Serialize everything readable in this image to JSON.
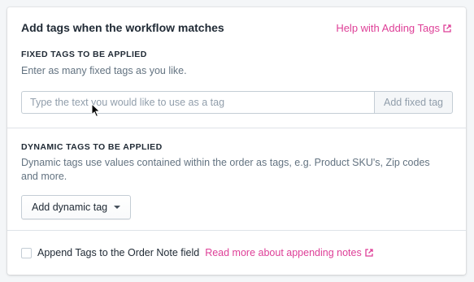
{
  "card": {
    "title": "Add tags when the workflow matches",
    "help_link": "Help with Adding Tags"
  },
  "fixed_tags": {
    "heading": "FIXED TAGS TO BE APPLIED",
    "hint": "Enter as many fixed tags as you like.",
    "input_placeholder": "Type the text you would like to use as a tag",
    "input_value": "",
    "add_button": "Add fixed tag"
  },
  "dynamic_tags": {
    "heading": "DYNAMIC TAGS TO BE APPLIED",
    "hint": "Dynamic tags use values contained within the order as tags, e.g. Product SKU's, Zip codes and more.",
    "add_button": "Add dynamic tag"
  },
  "append": {
    "label": "Append Tags to the Order Note field",
    "link": "Read more about appending notes",
    "checked": false
  },
  "icons": {
    "external": "external-link-icon",
    "caret": "caret-down-icon",
    "cursor": "mouse-pointer-icon"
  },
  "colors": {
    "link": "#de3f97",
    "border": "#c4cdd5",
    "muted_text": "#637381",
    "background": "#f4f6f8"
  }
}
